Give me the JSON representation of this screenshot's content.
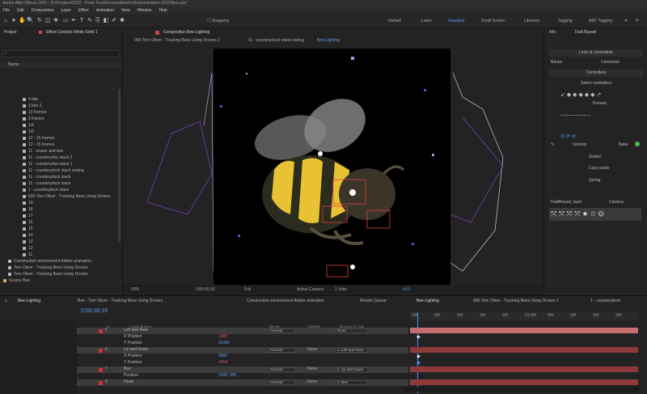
{
  "title_text": "Adobe After Effects 2022 - D:\\Dropbox\\2022 - Fonts Paulo\\LessonBeeForfinal\\animation 2022\\Bee.aep*",
  "menu": [
    "File",
    "Edit",
    "Composition",
    "Layer",
    "Effect",
    "Animation",
    "View",
    "Window",
    "Help"
  ],
  "toolbar": {
    "snapping_label": "Snapping",
    "workspaces": [
      "Default",
      "Learn",
      "Standard",
      "Small Screen",
      "Libraries",
      "Tagging",
      "ABC Tagging"
    ],
    "active_workspace": "Standard"
  },
  "project_panel": {
    "tab_project": "Project",
    "tab_effect_controls": "Effect Controls White Solid 1",
    "header_name": "Name",
    "items": [
      "4 bite",
      "3 bite 2",
      "10 frames",
      "2 frames",
      "1/4",
      "1/2",
      "12 - 15 frames",
      "12 - 15 frames",
      "11 - eraser and bee",
      "11 - counterydou stack 2",
      "11 - counterydou stack 1",
      "11 - counterydock stack ending",
      "11 - counterydock stack",
      "11 - counterydock stack",
      "1 - counterydock stack",
      "000-Tom Oliver - Tracking Bees Using Drones",
      "19",
      "18",
      "17",
      "16",
      "15",
      "14",
      "13",
      "12",
      "11",
      "10"
    ],
    "lower_items": [
      "Construction-environment Adobe animation",
      "Tom Oliver - Tracking Bees Using Drones",
      "Tom Oliver - Tracking Bees Using Drones",
      "Source Bee"
    ]
  },
  "comp_viewer": {
    "header": "Composition Bee-Lighting",
    "breadcrumbs": [
      "000-Tom Oliver - Tracking Bees Using Drones 2",
      "11 - counterydock stack ending",
      "Bee-Lighting"
    ],
    "footer_zoom": "50%",
    "footer_time": "0;00;00;16",
    "footer_res": "Full",
    "footer_camera": "Active Camera",
    "footer_view": "1 View",
    "footer_extra": "+0.0"
  },
  "right_panel": {
    "tabs": [
      "Info",
      "Duik Bassel"
    ],
    "links_label": "Links & constraints",
    "bones_label": "Bones",
    "controllers_label": "Controllers",
    "connect_label": "Connector",
    "select_controllers": "Select controllers",
    "presets_label": "Presets",
    "velocity_label": "Velocity",
    "bake_label": "Bake",
    "shaker_label": "Shaker",
    "jitter_label": "Copy paste",
    "spring_label": "Spring",
    "layer_tab": "DuikBassel_layer",
    "camera_tab": "Camera"
  },
  "timeline": {
    "tabs": [
      "Bee-Lighting",
      "Bee - Tom Oliver - Tracking Bees Using Drones",
      "Construction-environment Adobe animation",
      "Render Queue",
      "Bee-Lighting",
      "000-Tom Oliver - Tracking Bees Using Drones 2",
      "1 - counterydock"
    ],
    "timecode": "0;00;00;16",
    "col_headers": {
      "num": "#",
      "name": "Layer Name",
      "mode": "Mode",
      "trkmat": "TrkMat",
      "parent": "Parent & Link"
    },
    "ruler_ticks": [
      "00f",
      "05f",
      "10f",
      "15f",
      "20f",
      "01:00f",
      "05f",
      "10f",
      "15f",
      "20f"
    ],
    "layers": [
      {
        "num": "5",
        "name": "Left and Rear",
        "value": "",
        "mode": "Normal",
        "trk": "",
        "parent": "None"
      },
      {
        "num": "",
        "name": "X Position",
        "value": "3389",
        "mode": "",
        "trk": "",
        "parent": ""
      },
      {
        "num": "",
        "name": "Y Position",
        "value": "25490",
        "mode": "",
        "trk": "",
        "parent": ""
      },
      {
        "num": "6",
        "name": "Up and Down",
        "value": "",
        "mode": "Normal",
        "trk": "None",
        "parent": "1. Left and Rear"
      },
      {
        "num": "",
        "name": "X Position",
        "value": "3890",
        "mode": "",
        "trk": "",
        "parent": ""
      },
      {
        "num": "",
        "name": "Y Position",
        "value": "4454",
        "mode": "",
        "trk": "",
        "parent": ""
      },
      {
        "num": "7",
        "name": "Bee",
        "value": "",
        "mode": "Normal",
        "trk": "None",
        "parent": "2. Up and Down"
      },
      {
        "num": "",
        "name": "Position",
        "value": "1045, 905",
        "mode": "",
        "trk": "",
        "parent": ""
      },
      {
        "num": "8",
        "name": "Head",
        "value": "",
        "mode": "Normal",
        "trk": "None",
        "parent": "3. Bee"
      }
    ]
  }
}
